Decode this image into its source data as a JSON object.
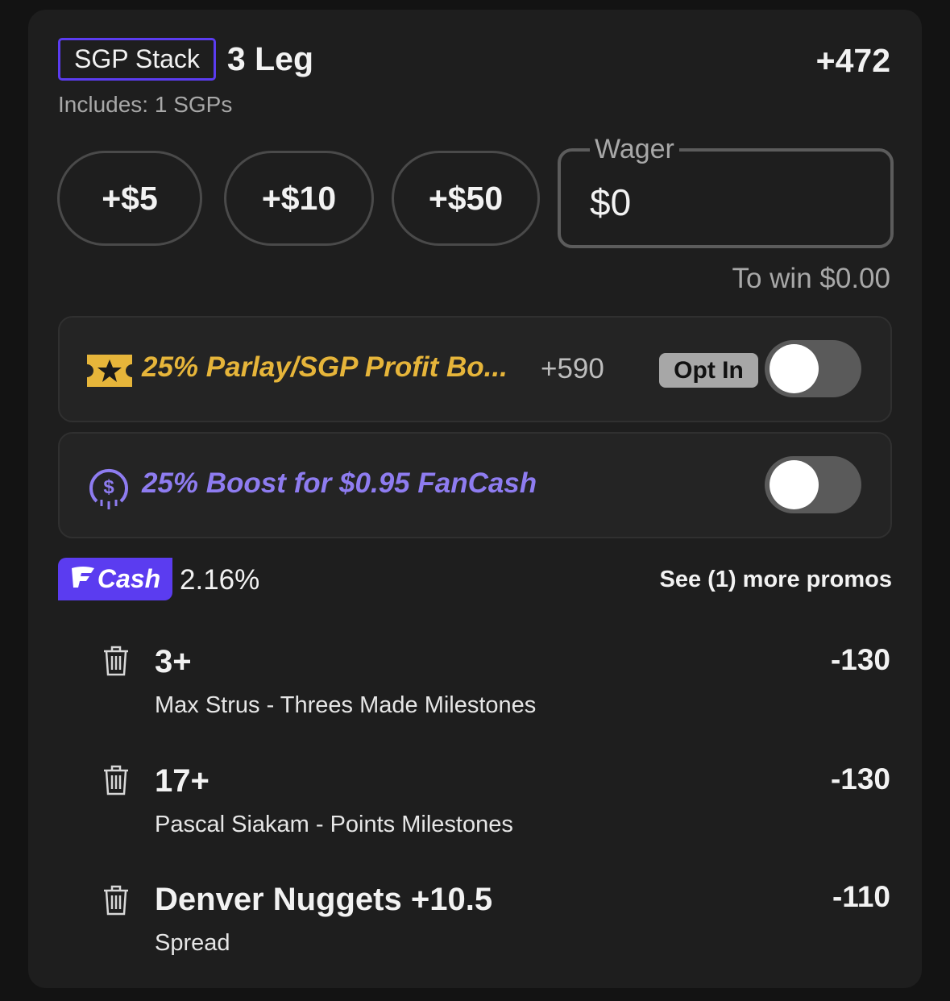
{
  "header": {
    "badge": "SGP Stack",
    "title": "3 Leg",
    "odds": "+472",
    "includes": "Includes: 1 SGPs"
  },
  "quick_amounts": [
    "+$5",
    "+$10",
    "+$50"
  ],
  "wager": {
    "label": "Wager",
    "value": "$0"
  },
  "to_win": "To win $0.00",
  "promos": [
    {
      "text": "25% Parlay/SGP Profit Bo...",
      "boosted_odds": "+590",
      "opt_in": "Opt In",
      "icon": "star-ticket-icon",
      "color": "#e6b53a",
      "enabled": false
    },
    {
      "text": "25% Boost for $0.95 FanCash",
      "icon": "fancash-coin-icon",
      "color": "#8e7cf0",
      "enabled": false
    }
  ],
  "fancash": {
    "logo": "Cash",
    "percent": "2.16%",
    "more_promos": "See (1) more promos",
    "color": "#5b3cf0"
  },
  "legs": [
    {
      "selection": "3+",
      "description": "Max Strus - Threes Made Milestones",
      "odds": "-130"
    },
    {
      "selection": "17+",
      "description": "Pascal Siakam - Points Milestones",
      "odds": "-130"
    },
    {
      "selection": "Denver Nuggets +10.5",
      "description": "Spread",
      "odds": "-110"
    }
  ]
}
